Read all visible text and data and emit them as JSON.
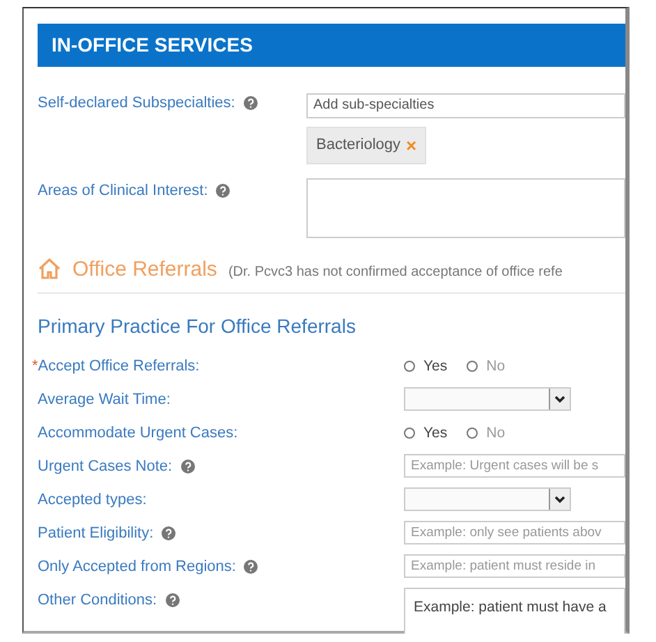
{
  "section": {
    "title": "IN-OFFICE SERVICES"
  },
  "services_fields": [
    {
      "label": "Self-declared Subspecialties:",
      "help": true,
      "kind": "tags",
      "placeholder": "Add sub-specialties",
      "tags": [
        {
          "label": "Bacteriology",
          "remove": "×"
        }
      ]
    },
    {
      "label": "Areas of Clinical Interest:",
      "help": true,
      "kind": "textarea"
    }
  ],
  "referrals": {
    "title": "Office Referrals",
    "note": "(Dr. Pcvc3 has not confirmed acceptance of office refe",
    "subtitle": "Primary Practice For Office Referrals",
    "fields": [
      {
        "label": "Accept Office Referrals:",
        "required_mark": "*",
        "help": false,
        "kind": "radio",
        "options": [
          {
            "label": "Yes",
            "selected": false
          },
          {
            "label": "No",
            "selected": false
          }
        ]
      },
      {
        "label": "Average Wait Time:",
        "help": false,
        "kind": "select"
      },
      {
        "label": "Accommodate Urgent Cases:",
        "help": false,
        "kind": "radio",
        "options": [
          {
            "label": "Yes",
            "selected": false
          },
          {
            "label": "No",
            "selected": false
          }
        ]
      },
      {
        "label": "Urgent Cases Note:",
        "help": true,
        "kind": "text",
        "placeholder": "Example: Urgent cases will be s"
      },
      {
        "label": "Accepted types:",
        "help": false,
        "kind": "select"
      },
      {
        "label": "Patient Eligibility:",
        "help": true,
        "kind": "text",
        "placeholder": "Example: only see patients abov"
      },
      {
        "label": "Only Accepted from Regions:",
        "help": true,
        "kind": "text",
        "placeholder": "Example: patient must reside in"
      },
      {
        "label": "Other Conditions:",
        "help": true,
        "kind": "textarea",
        "placeholder": "Example: patient must have a"
      }
    ]
  }
}
